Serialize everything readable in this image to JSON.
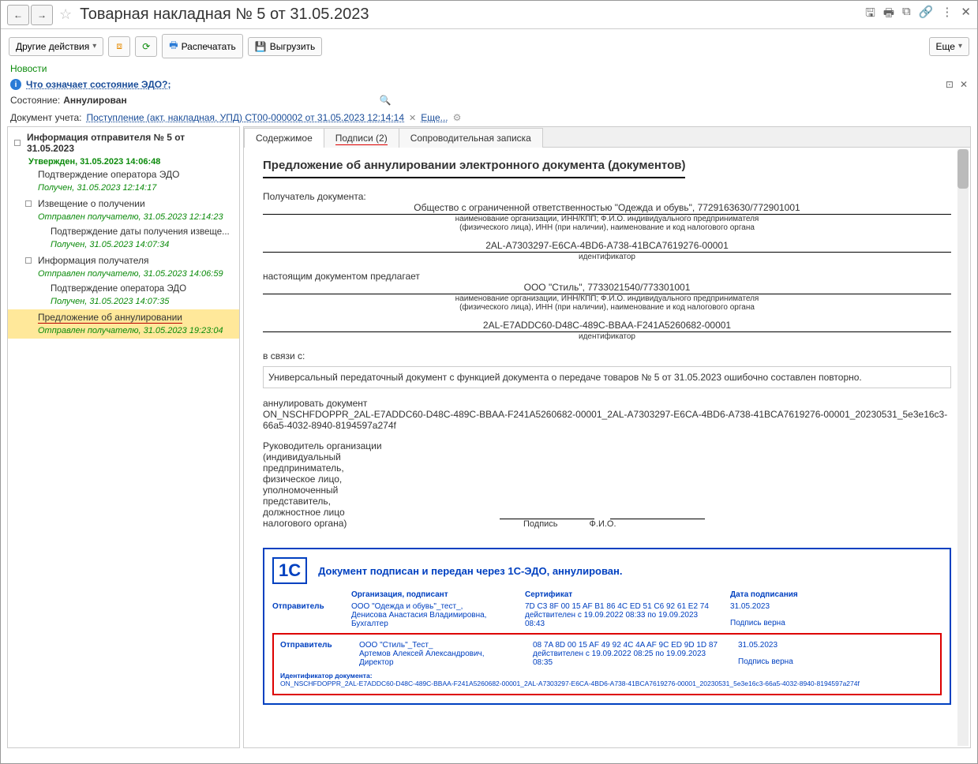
{
  "title": "Товарная накладная № 5 от 31.05.2023",
  "toolbar": {
    "other_actions": "Другие действия",
    "print": "Распечатать",
    "export": "Выгрузить",
    "more": "Еще"
  },
  "news": "Новости",
  "help_link": "Что означает состояние ЭДО?;",
  "state_label": "Состояние:",
  "state_value": "Аннулирован",
  "docline_label": "Документ учета:",
  "docline_link": "Поступление (акт, накладная, УПД) СТ00-000002 от 31.05.2023 12:14:14",
  "docline_more": "Еще...",
  "tree": {
    "root": "Информация отправителя № 5 от 31.05.2023",
    "root_status": "Утвержден, 31.05.2023 14:06:48",
    "n1": "Подтверждение оператора ЭДО",
    "s1": "Получен, 31.05.2023 12:14:17",
    "n2": "Извещение о получении",
    "s2": "Отправлен получателю, 31.05.2023 12:14:23",
    "n3": "Подтверждение даты получения извеще...",
    "s3": "Получен, 31.05.2023 14:07:34",
    "n4": "Информация получателя",
    "s4": "Отправлен получателю, 31.05.2023 14:06:59",
    "n5": "Подтверждение оператора ЭДО",
    "s5": "Получен, 31.05.2023 14:07:35",
    "n6": "Предложение об аннулировании",
    "s6": "Отправлен получателю, 31.05.2023 19:23:04"
  },
  "tabs": {
    "t1": "Содержимое",
    "t2": "Подписи (2)",
    "t3": "Сопроводительная записка"
  },
  "doc": {
    "title": "Предложение об аннулировании электронного документа (документов)",
    "recipient_label": "Получатель документа:",
    "recipient": "Общество с ограниченной ответственностью \"Одежда и обувь\", 7729163630/772901001",
    "org_note": "наименование организации, ИНН/КПП; Ф.И.О. индивидуального предпринимателя",
    "org_note2": "(физического лица), ИНН (при наличии), наименование и код налогового органа",
    "recipient_id": "2AL-A7303297-E6CA-4BD6-A738-41BCA7619276-00001",
    "id_label": "идентификатор",
    "proposes": "настоящим документом предлагает",
    "sender": "ООО \"Стиль\", 7733021540/773301001",
    "sender_id": "2AL-E7ADDC60-D48C-489C-BBAA-F241A5260682-00001",
    "reason_label": "в связи с:",
    "reason": "Универсальный передаточный документ с функцией документа о передаче товаров № 5 от 31.05.2023 ошибочно составлен повторно.",
    "cancel_label": "аннулировать документ",
    "doc_id": "ON_NSCHFDOPPR_2AL-E7ADDC60-D48C-489C-BBAA-F241A5260682-00001_2AL-A7303297-E6CA-4BD6-A738-41BCA7619276-00001_20230531_5e3e16c3-66a5-4032-8940-8194597a274f",
    "head_label": "Руководитель организации\n(индивидуальный\nпредприниматель,\nфизическое лицо,\nуполномоченный\nпредставитель,\nдолжностное лицо\nналогового органа)",
    "sig": "Подпись",
    "fio": "Ф.И.О."
  },
  "stamp": {
    "head": "Документ подписан и передан через 1С-ЭДО, аннулирован.",
    "col_org": "Организация, подписант",
    "col_cert": "Сертификат",
    "col_date": "Дата подписания",
    "r1_role": "Отправитель",
    "r1_org": "ООО \"Одежда и обувь\"_тест_,\nДенисова Анастасия Владимировна,\nБухгалтер",
    "r1_cert": "7D C3 8F 00 15 AF B1 86 4C ED 51 C6 92 61 E2 74\nдействителен с 19.09.2022 08:33 по 19.09.2023 08:43",
    "r1_date": "31.05.2023",
    "r1_valid": "Подпись верна",
    "r2_role": "Отправитель",
    "r2_org": "ООО \"Стиль\"_Тест_\nАртемов Алексей Александрович, Директор",
    "r2_cert": "08 7A 8D 00 15 AF 49 92 4C 4A AF 9C ED 9D 1D 87\nдействителен с 19.09.2022 08:25 по 19.09.2023 08:35",
    "r2_date": "31.05.2023",
    "r2_valid": "Подпись верна",
    "id_label": "Идентификатор документа:",
    "id": "ON_NSCHFDOPPR_2AL-E7ADDC60-D48C-489C-BBAA-F241A5260682-00001_2AL-A7303297-E6CA-4BD6-A738-41BCA7619276-00001_20230531_5e3e16c3-66a5-4032-8940-8194597a274f"
  }
}
